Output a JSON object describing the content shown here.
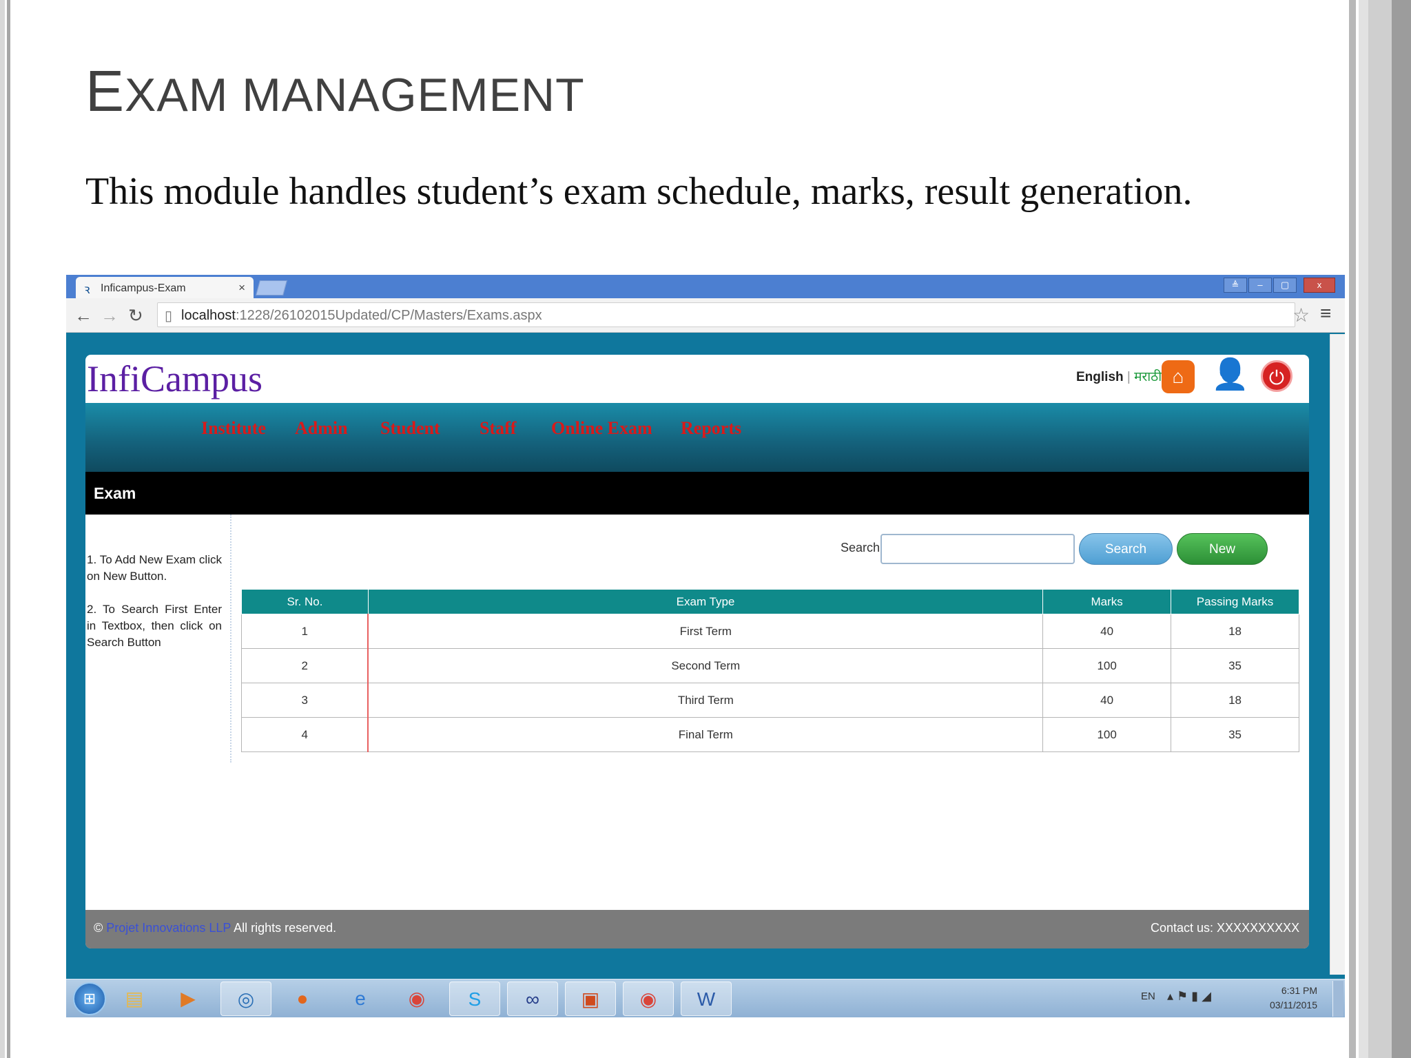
{
  "slide": {
    "title_first": "E",
    "title_rest": "XAM MANAGEMENT",
    "subtitle": "This module handles student’s exam schedule, marks, result generation."
  },
  "browser": {
    "tab_title": "Inficampus-Exam",
    "tab_close": "×",
    "url_host": "localhost",
    "url_path": ":1228/26102015Updated/CP/Masters/Exams.aspx",
    "window_controls": [
      "≜",
      "–",
      "▢",
      "x"
    ]
  },
  "app": {
    "logo": "InfiCampus",
    "lang_english": "English",
    "lang_sep": " | ",
    "lang_marathi": "मराठी",
    "nav": [
      "Institute",
      "Admin",
      "Student",
      "Staff",
      "Online Exam",
      "Reports"
    ],
    "section_title": "Exam",
    "help": [
      "1. To Add New Exam click on New Button.",
      "2. To Search First Enter in Textbox, then click on Search Button"
    ],
    "search_label": "Search",
    "search_value": "",
    "search_button": "Search",
    "new_button": "New",
    "table": {
      "headers": [
        "Sr. No.",
        "Exam Type",
        "Marks",
        "Passing Marks"
      ],
      "rows": [
        [
          "1",
          "First Term",
          "40",
          "18"
        ],
        [
          "2",
          "Second Term",
          "100",
          "35"
        ],
        [
          "3",
          "Third Term",
          "40",
          "18"
        ],
        [
          "4",
          "Final Term",
          "100",
          "35"
        ]
      ]
    },
    "footer": {
      "copyright_symbol": "©",
      "company": "Projet Innovations LLP",
      "rights": "All rights reserved.",
      "contact": "Contact us:   XXXXXXXXXX"
    }
  },
  "taskbar": {
    "lang": "EN",
    "time": "6:31 PM",
    "date": "03/11/2015"
  },
  "colors": {
    "browser_titlebar": "#4c7fd1",
    "page_background": "#0f779d",
    "nav_text": "#d91a1a",
    "table_header": "#0f8a8a",
    "logo": "#5b1fa3",
    "new_button": "#2c8f36",
    "search_button": "#4f9fd3"
  }
}
